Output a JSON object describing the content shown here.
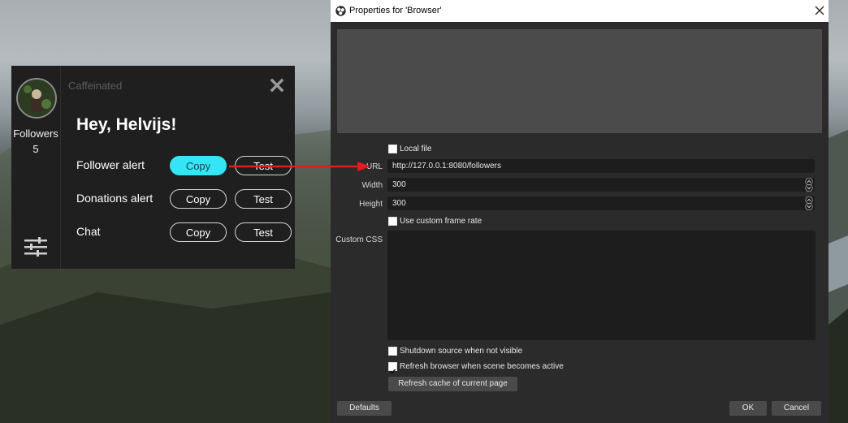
{
  "widget": {
    "app_title": "Caffeinated",
    "side_label": "Followers",
    "side_count": "5",
    "greeting": "Hey, Helvijs!",
    "rows": [
      {
        "label": "Follower alert",
        "copy": "Copy",
        "test": "Test"
      },
      {
        "label": "Donations alert",
        "copy": "Copy",
        "test": "Test"
      },
      {
        "label": "Chat",
        "copy": "Copy",
        "test": "Test"
      }
    ],
    "accent_color": "#34e6f5"
  },
  "dialog": {
    "title": "Properties for 'Browser'",
    "local_file_label": "Local file",
    "url_label": "URL",
    "url_value": "http://127.0.0.1:8080/followers",
    "width_label": "Width",
    "width_value": "300",
    "height_label": "Height",
    "height_value": "300",
    "custom_frame_rate_label": "Use custom frame rate",
    "custom_css_label": "Custom CSS",
    "shutdown_label": "Shutdown source when not visible",
    "refresh_label": "Refresh browser when scene becomes active",
    "refresh_cache_button": "Refresh cache of current page",
    "defaults_button": "Defaults",
    "ok_button": "OK",
    "cancel_button": "Cancel",
    "checkboxes": {
      "local_file": false,
      "custom_frame_rate": false,
      "shutdown": false,
      "refresh_on_active": true
    }
  },
  "annotation_arrow_color": "#e21b1b"
}
